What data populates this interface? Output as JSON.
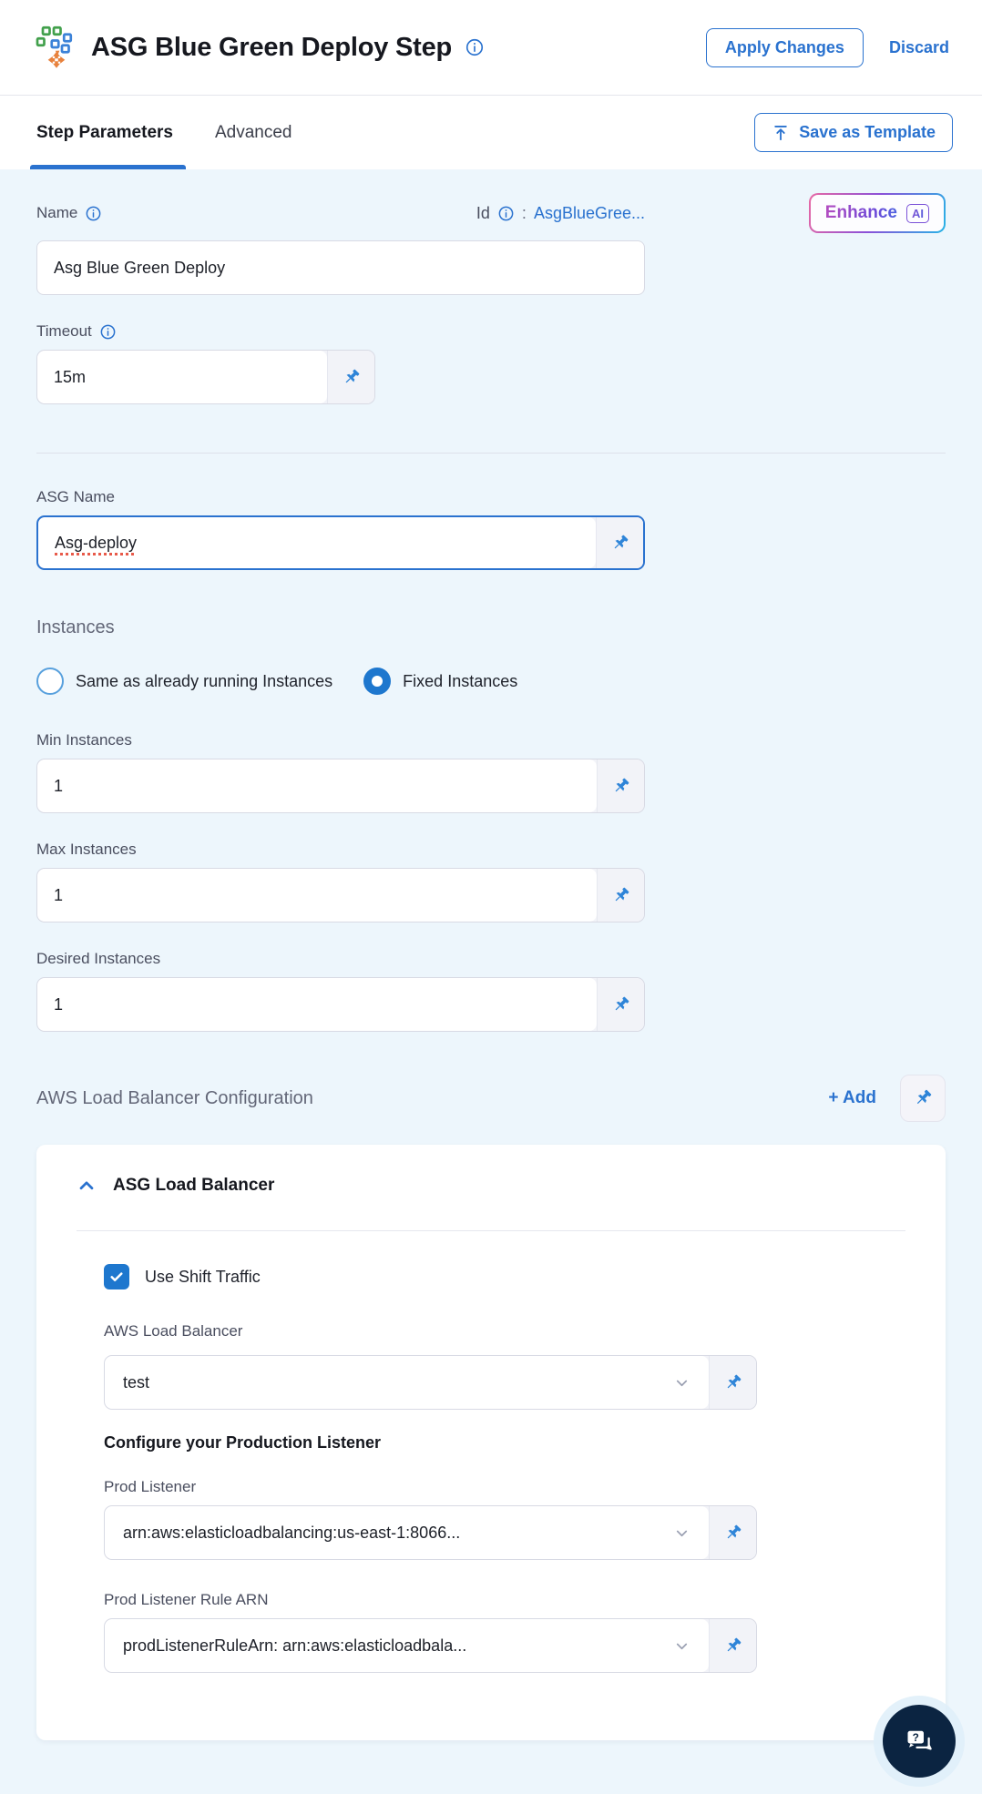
{
  "header": {
    "title": "ASG Blue Green Deploy Step",
    "apply_label": "Apply Changes",
    "discard_label": "Discard"
  },
  "tabs": {
    "step_parameters": "Step Parameters",
    "advanced": "Advanced",
    "save_as_template": "Save as Template"
  },
  "form": {
    "name": {
      "label": "Name",
      "value": "Asg Blue Green Deploy"
    },
    "id": {
      "label": "Id",
      "separator": ":",
      "value": "AsgBlueGree..."
    },
    "enhance": {
      "label": "Enhance",
      "badge": "AI"
    },
    "timeout": {
      "label": "Timeout",
      "value": "15m"
    },
    "asg_name": {
      "label": "ASG Name",
      "value": "Asg-deploy"
    },
    "instances": {
      "heading": "Instances",
      "options": [
        {
          "label": "Same as already running Instances",
          "selected": false
        },
        {
          "label": "Fixed Instances",
          "selected": true
        }
      ]
    },
    "min_instances": {
      "label": "Min Instances",
      "value": "1"
    },
    "max_instances": {
      "label": "Max Instances",
      "value": "1"
    },
    "desired_instances": {
      "label": "Desired Instances",
      "value": "1"
    }
  },
  "lb_section": {
    "heading": "AWS Load Balancer Configuration",
    "add_label": "+ Add",
    "card": {
      "title": "ASG Load Balancer",
      "use_shift_traffic_label": "Use Shift Traffic",
      "use_shift_traffic_checked": true,
      "aws_lb": {
        "label": "AWS Load Balancer",
        "value": "test"
      },
      "prod_heading": "Configure your Production Listener",
      "prod_listener": {
        "label": "Prod Listener",
        "value": "arn:aws:elasticloadbalancing:us-east-1:8066..."
      },
      "prod_listener_rule": {
        "label": "Prod Listener Rule ARN",
        "value": "prodListenerRuleArn: arn:aws:elasticloadbala..."
      }
    }
  },
  "icons": {
    "asg_step": "asg-squares-with-move-arrow",
    "info": "circle-i",
    "pin": "pushpin",
    "save_template": "arrow-up-from-bar",
    "chevron_down": "chevron-down",
    "chevron_up": "chevron-up",
    "chat": "question-speech-bubbles"
  },
  "colors": {
    "accent_blue": "#2a72cf",
    "form_background": "#edf6fc",
    "checkbox_blue": "#1e77ce",
    "chat_navy": "#0b2441",
    "squiggle_red": "#e85a4a",
    "enhance_gradient": [
      "#e869a4",
      "#8a50d8",
      "#27b4e6"
    ],
    "asg_icon_green": "#42a04c",
    "asg_icon_blue": "#3b82d8",
    "asg_icon_orange": "#e8823d"
  }
}
